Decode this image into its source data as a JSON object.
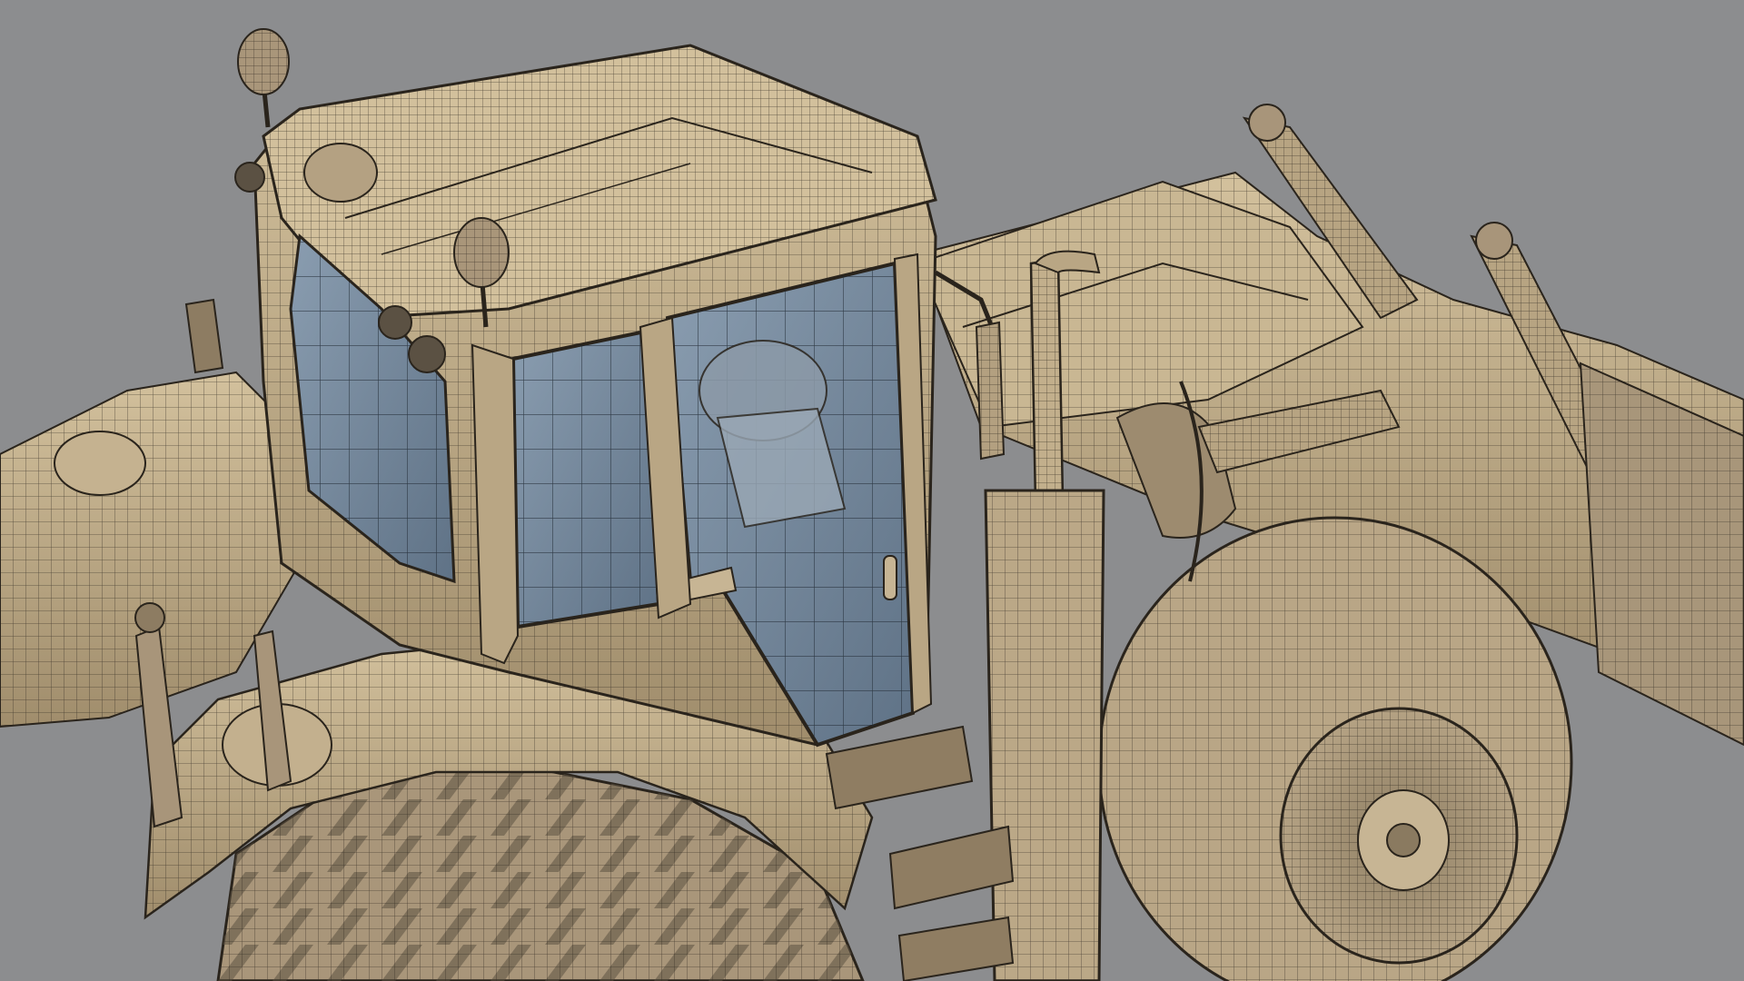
{
  "scene": {
    "background_color": "#8c8d8f",
    "model_base_color": "#bba98a",
    "model_light_color": "#d9c9a6",
    "model_shadow_color": "#6e6250",
    "wire_color": "#2a241c",
    "glass_color": "#7d91a6",
    "glass_dark_color": "#5e7084"
  }
}
